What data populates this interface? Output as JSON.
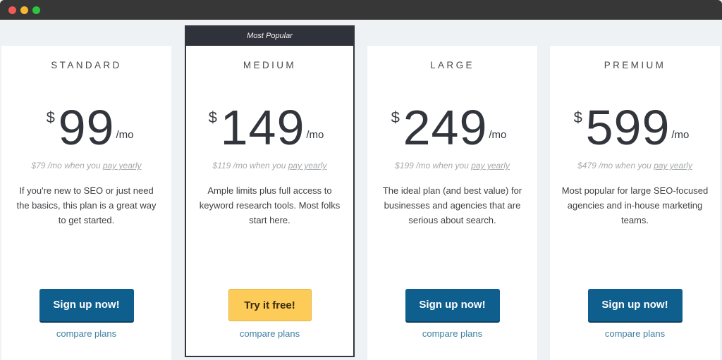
{
  "window": {
    "controls": [
      "close",
      "minimize",
      "maximize"
    ]
  },
  "colors": {
    "titlebar": "#373737",
    "page_bg": "#eef2f5",
    "primary_button": "#0e5e8e",
    "highlight_button": "#fccb58",
    "badge_bg": "#30323b",
    "link": "#3f7fa3"
  },
  "plans": [
    {
      "name": "STANDARD",
      "currency": "$",
      "price": "99",
      "period": "/mo",
      "yearly_prefix": "$79 /mo when you ",
      "yearly_link": "pay yearly",
      "description": "If you're new to SEO or just need the basics, this plan is a great way to get started.",
      "cta": "Sign up now!",
      "compare": "compare plans"
    },
    {
      "badge": "Most Popular",
      "name": "MEDIUM",
      "currency": "$",
      "price": "149",
      "period": "/mo",
      "yearly_prefix": "$119 /mo when you ",
      "yearly_link": "pay yearly",
      "description": "Ample limits plus full access to keyword research tools. Most folks start here.",
      "cta": "Try it free!",
      "compare": "compare plans"
    },
    {
      "name": "LARGE",
      "currency": "$",
      "price": "249",
      "period": "/mo",
      "yearly_prefix": "$199 /mo when you ",
      "yearly_link": "pay yearly",
      "description": "The ideal plan (and best value) for businesses and agencies that are serious about search.",
      "cta": "Sign up now!",
      "compare": "compare plans"
    },
    {
      "name": "PREMIUM",
      "currency": "$",
      "price": "599",
      "period": "/mo",
      "yearly_prefix": "$479 /mo when you ",
      "yearly_link": "pay yearly",
      "description": "Most popular for large SEO-focused agencies and in-house marketing teams.",
      "cta": "Sign up now!",
      "compare": "compare plans"
    }
  ]
}
